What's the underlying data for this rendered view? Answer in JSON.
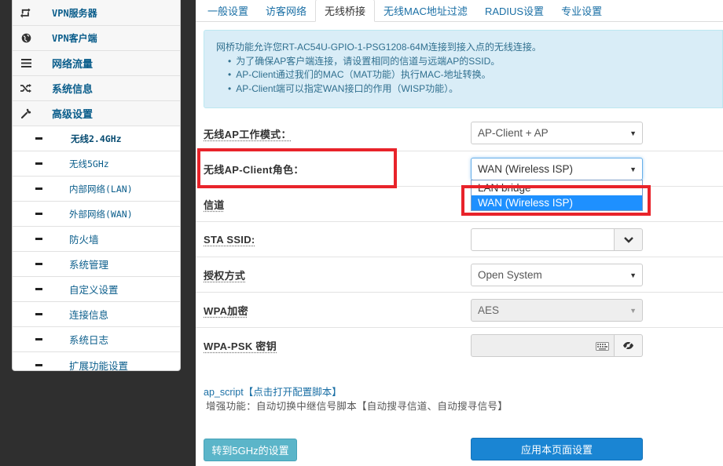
{
  "sidebar": {
    "items": [
      {
        "label": "VPN服务器",
        "icon": "vpn-server-icon"
      },
      {
        "label": "VPN客户端",
        "icon": "globe-icon"
      },
      {
        "label": "网络流量",
        "icon": "list-icon"
      },
      {
        "label": "系统信息",
        "icon": "shuffle-icon"
      },
      {
        "label": "高级设置",
        "icon": "wrench-icon"
      }
    ],
    "subitems": [
      {
        "label": "无线2.4GHz",
        "active": true
      },
      {
        "label": "无线5GHz"
      },
      {
        "label": "内部网络(LAN)"
      },
      {
        "label": "外部网络(WAN)"
      },
      {
        "label": "防火墙"
      },
      {
        "label": "系统管理"
      },
      {
        "label": "自定义设置"
      },
      {
        "label": "连接信息"
      },
      {
        "label": "系统日志"
      },
      {
        "label": "扩展功能设置"
      }
    ]
  },
  "tabs": [
    "一般设置",
    "访客网络",
    "无线桥接",
    "无线MAC地址过滤",
    "RADIUS设置",
    "专业设置"
  ],
  "active_tab": "无线桥接",
  "info": {
    "intro": "网桥功能允许您RT-AC54U-GPIO-1-PSG1208-64M连接到接入点的无线连接。",
    "bullets": [
      "为了确保AP客户端连接，请设置相同的信道与远端AP的SSID。",
      "AP-Client通过我们的MAC（MAT功能）执行MAC-地址转换。",
      "AP-Client端可以指定WAN接口的作用（WISP功能）。"
    ]
  },
  "form": {
    "mode_label": "无线AP工作模式：",
    "mode_value": "AP-Client + AP",
    "role_label": "无线AP-Client角色：",
    "role_value": "WAN (Wireless ISP)",
    "role_options": [
      "LAN bridge",
      "WAN (Wireless ISP)"
    ],
    "channel_label": "信道",
    "ssid_label": "STA SSID:",
    "ssid_value": "",
    "auth_label": "授权方式",
    "auth_value": "Open System",
    "wpa_label": "WPA加密",
    "wpa_value": "AES",
    "psk_label": "WPA-PSK 密钥",
    "psk_value": ""
  },
  "script_link": "ap_script【点击打开配置脚本】",
  "enhance_text": "增强功能：自动切换中继信号脚本【自动搜寻信道、自动搜寻信号】",
  "buttons": {
    "to5g": "转到5GHz的设置",
    "apply": "应用本页面设置"
  },
  "colors": {
    "highlight": "#e8232a",
    "info_bg": "#d9edf7",
    "apply_btn": "#1a85d3",
    "secondary_btn": "#5bb5c9",
    "selected_option": "#1e90ff"
  }
}
